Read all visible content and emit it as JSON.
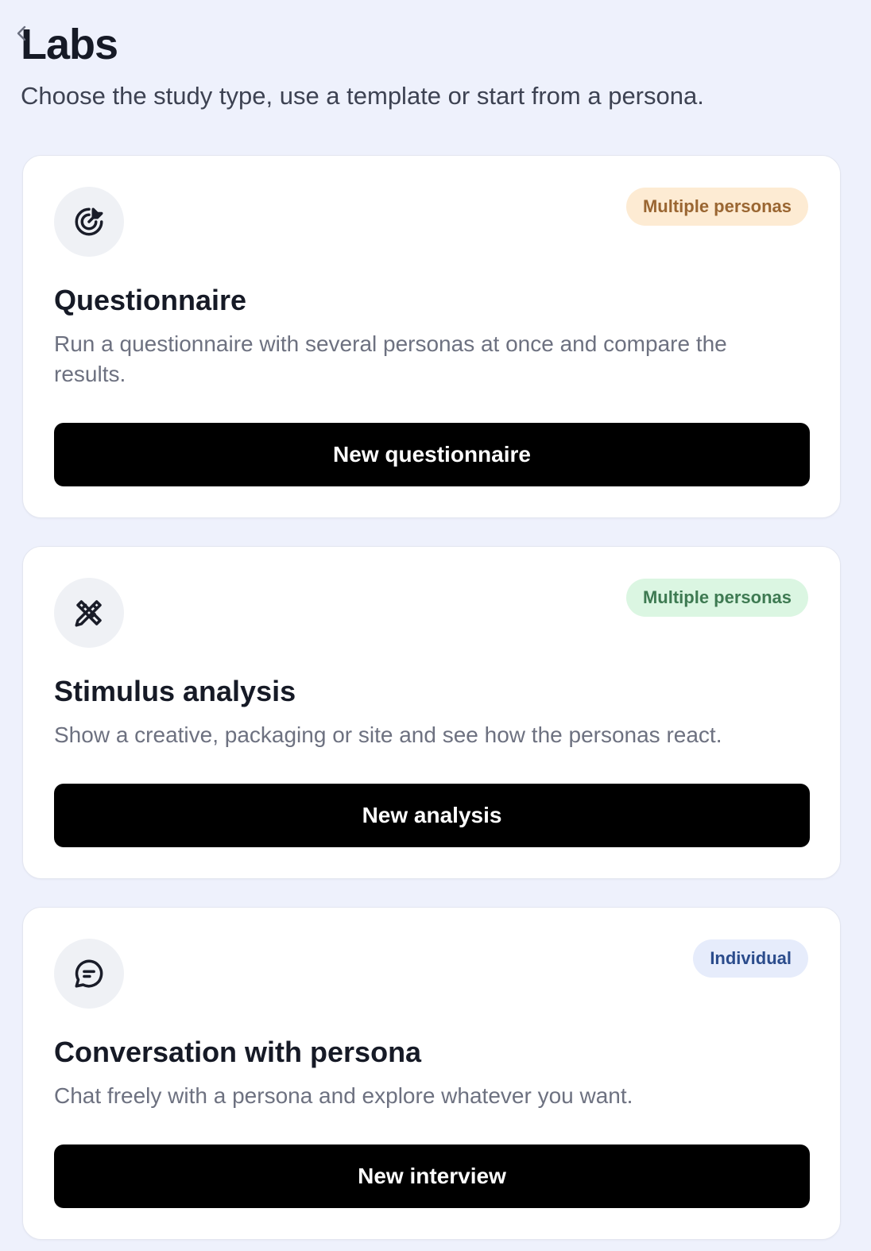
{
  "header": {
    "title": "Labs",
    "subtitle": "Choose the study type, use a template or start from a persona."
  },
  "cards": [
    {
      "icon": "target-icon",
      "badge": "Multiple personas",
      "badge_bg": "#fdebd3",
      "badge_color": "#9a6632",
      "title": "Questionnaire",
      "description": "Run a questionnaire with several personas at once and compare the results.",
      "button_label": "New questionnaire"
    },
    {
      "icon": "pencil-ruler-icon",
      "badge": "Multiple personas",
      "badge_bg": "#dbf6e2",
      "badge_color": "#3e7a52",
      "title": "Stimulus analysis",
      "description": "Show a creative, packaging or site and see how the personas react.",
      "button_label": "New analysis"
    },
    {
      "icon": "chat-bubble-icon",
      "badge": "Individual",
      "badge_bg": "#e6ecfb",
      "badge_color": "#2b4c8c",
      "title": "Conversation with persona",
      "description": "Chat freely with a persona and explore whatever you want.",
      "button_label": "New interview"
    }
  ]
}
